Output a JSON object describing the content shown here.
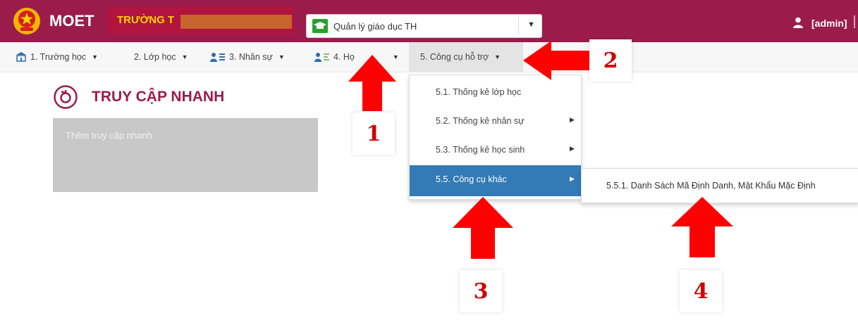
{
  "header": {
    "brand": "MOET",
    "school_label": "TRƯỜNG T",
    "module_select_value": "Quản lý giáo dục TH",
    "user": "[admin]"
  },
  "nav": {
    "items": [
      {
        "label": "1. Trường học"
      },
      {
        "label": "2. Lớp học"
      },
      {
        "label": "3. Nhân sự"
      },
      {
        "label": "4. Họ"
      },
      {
        "label": "5. Công cụ hỗ trợ"
      }
    ]
  },
  "dropdown": {
    "items": [
      {
        "label": "5.1. Thống kê lớp học"
      },
      {
        "label": "5.2. Thống kê nhân sự"
      },
      {
        "label": "5.3. Thống kê học sinh"
      },
      {
        "label": "5.5. Công cụ khác"
      }
    ],
    "submenu_item": "5.5.1. Danh Sách Mã Định Danh, Mật Khẩu Mặc Định"
  },
  "quick_access": {
    "title": "TRUY CẬP NHANH",
    "add_label": "Thêm truy cập nhanh"
  },
  "annotations": {
    "numbers": [
      "1",
      "2",
      "3",
      "4"
    ],
    "color": "#ff0000"
  },
  "colors": {
    "header_bg": "#9b1c4b",
    "active_menu_bg": "#337ab7",
    "title_color": "#9b1c4b"
  }
}
